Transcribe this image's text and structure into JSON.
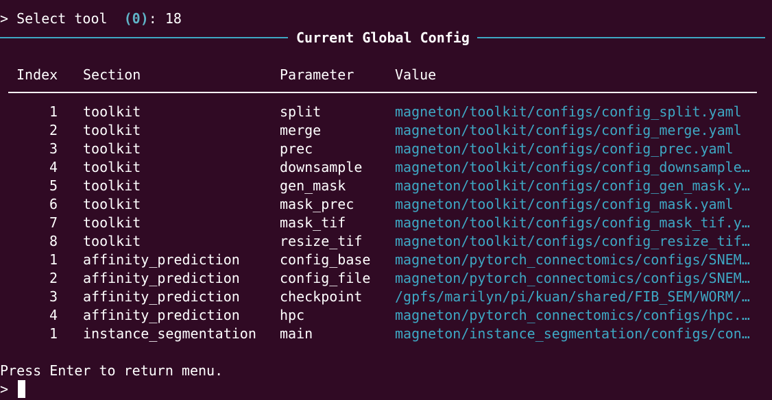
{
  "prompt": {
    "prefix": "> Select tool ",
    "default": "(0)",
    "suffix": ": 18"
  },
  "table": {
    "title": "Current Global Config",
    "headers": {
      "index": "Index",
      "section": "Section",
      "parameter": "Parameter",
      "value": "Value"
    },
    "rows": [
      {
        "index": "1",
        "section": "toolkit",
        "parameter": "split",
        "value": "magneton/toolkit/configs/config_split.yaml"
      },
      {
        "index": "2",
        "section": "toolkit",
        "parameter": "merge",
        "value": "magneton/toolkit/configs/config_merge.yaml"
      },
      {
        "index": "3",
        "section": "toolkit",
        "parameter": "prec",
        "value": "magneton/toolkit/configs/config_prec.yaml"
      },
      {
        "index": "4",
        "section": "toolkit",
        "parameter": "downsample",
        "value": "magneton/toolkit/configs/config_downsample…"
      },
      {
        "index": "5",
        "section": "toolkit",
        "parameter": "gen_mask",
        "value": "magneton/toolkit/configs/config_gen_mask.y…"
      },
      {
        "index": "6",
        "section": "toolkit",
        "parameter": "mask_prec",
        "value": "magneton/toolkit/configs/config_mask.yaml"
      },
      {
        "index": "7",
        "section": "toolkit",
        "parameter": "mask_tif",
        "value": "magneton/toolkit/configs/config_mask_tif.y…"
      },
      {
        "index": "8",
        "section": "toolkit",
        "parameter": "resize_tif",
        "value": "magneton/toolkit/configs/config_resize_tif…"
      },
      {
        "index": "1",
        "section": "affinity_prediction",
        "parameter": "config_base",
        "value": "magneton/pytorch_connectomics/configs/SNEM…"
      },
      {
        "index": "2",
        "section": "affinity_prediction",
        "parameter": "config_file",
        "value": "magneton/pytorch_connectomics/configs/SNEM…"
      },
      {
        "index": "3",
        "section": "affinity_prediction",
        "parameter": "checkpoint",
        "value": "/gpfs/marilyn/pi/kuan/shared/FIB_SEM/WORM/…"
      },
      {
        "index": "4",
        "section": "affinity_prediction",
        "parameter": "hpc",
        "value": "magneton/pytorch_connectomics/configs/hpc.…"
      },
      {
        "index": "1",
        "section": "instance_segmentation",
        "parameter": "main",
        "value": "magneton/instance_segmentation/configs/con…"
      }
    ]
  },
  "footer": {
    "message": "Press Enter to return menu.",
    "input_prompt": ">"
  },
  "colors": {
    "background": "#300a24",
    "accent": "#3ea8c4",
    "text": "#ffffff"
  }
}
